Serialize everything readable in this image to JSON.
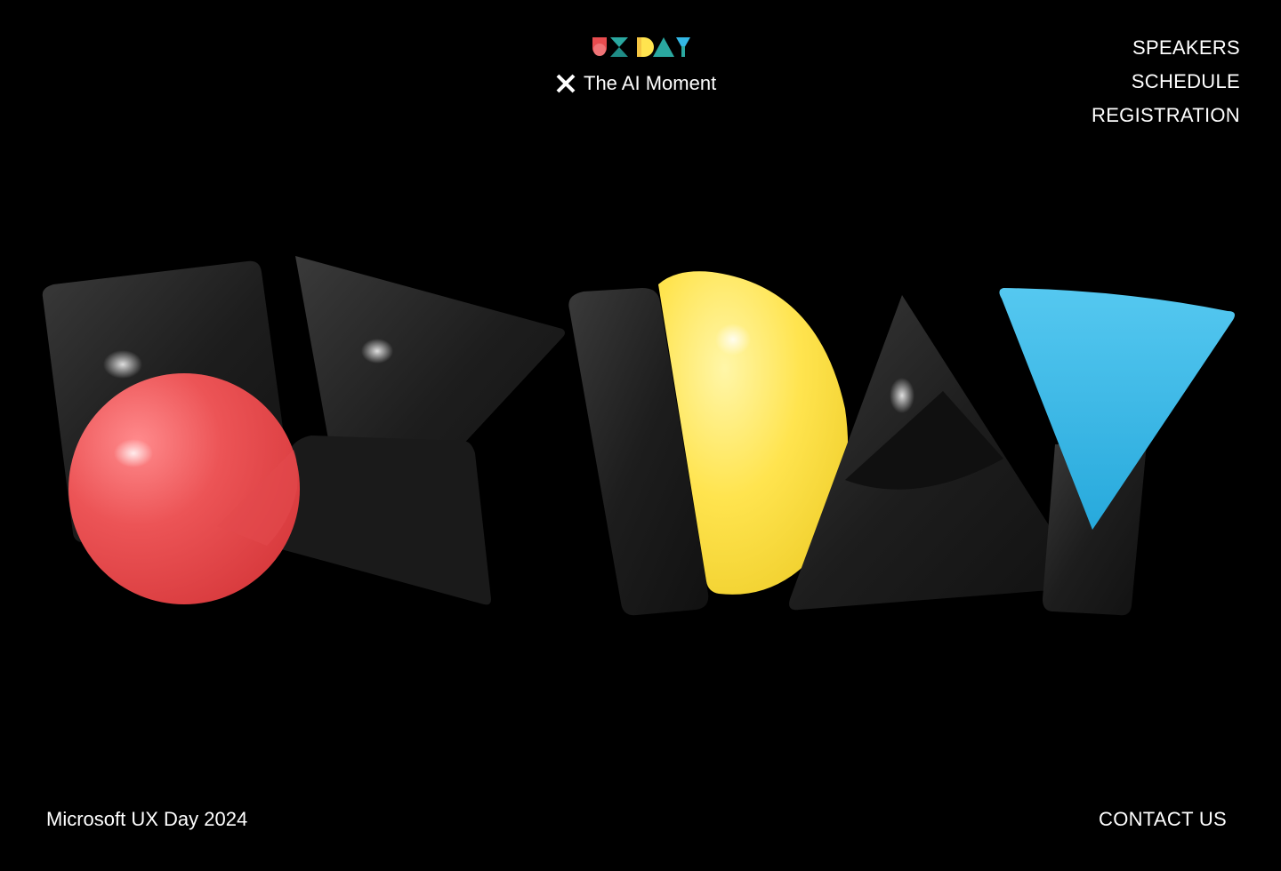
{
  "header": {
    "logo_text": "UX DAY",
    "tagline": "The AI Moment",
    "close_icon": "x-icon"
  },
  "nav": {
    "items": [
      {
        "label": "SPEAKERS"
      },
      {
        "label": "SCHEDULE"
      },
      {
        "label": "REGISTRATION"
      }
    ]
  },
  "hero": {
    "artwork": "3D shapes spelling UX DAY",
    "shapes": [
      {
        "name": "sphere",
        "color": "#e84c4f"
      },
      {
        "name": "half-disc",
        "color": "#ffe44f"
      },
      {
        "name": "triangle",
        "color": "#33b8e6"
      },
      {
        "name": "dark-shapes",
        "color": "#1c1c1c"
      }
    ]
  },
  "footer": {
    "event_name": "Microsoft UX Day 2024",
    "contact_label": "CONTACT US"
  },
  "colors": {
    "background": "#000000",
    "text": "#ffffff",
    "red": "#e84c4f",
    "yellow": "#ffe44f",
    "blue": "#33b8e6",
    "teal": "#2aa8a0"
  }
}
